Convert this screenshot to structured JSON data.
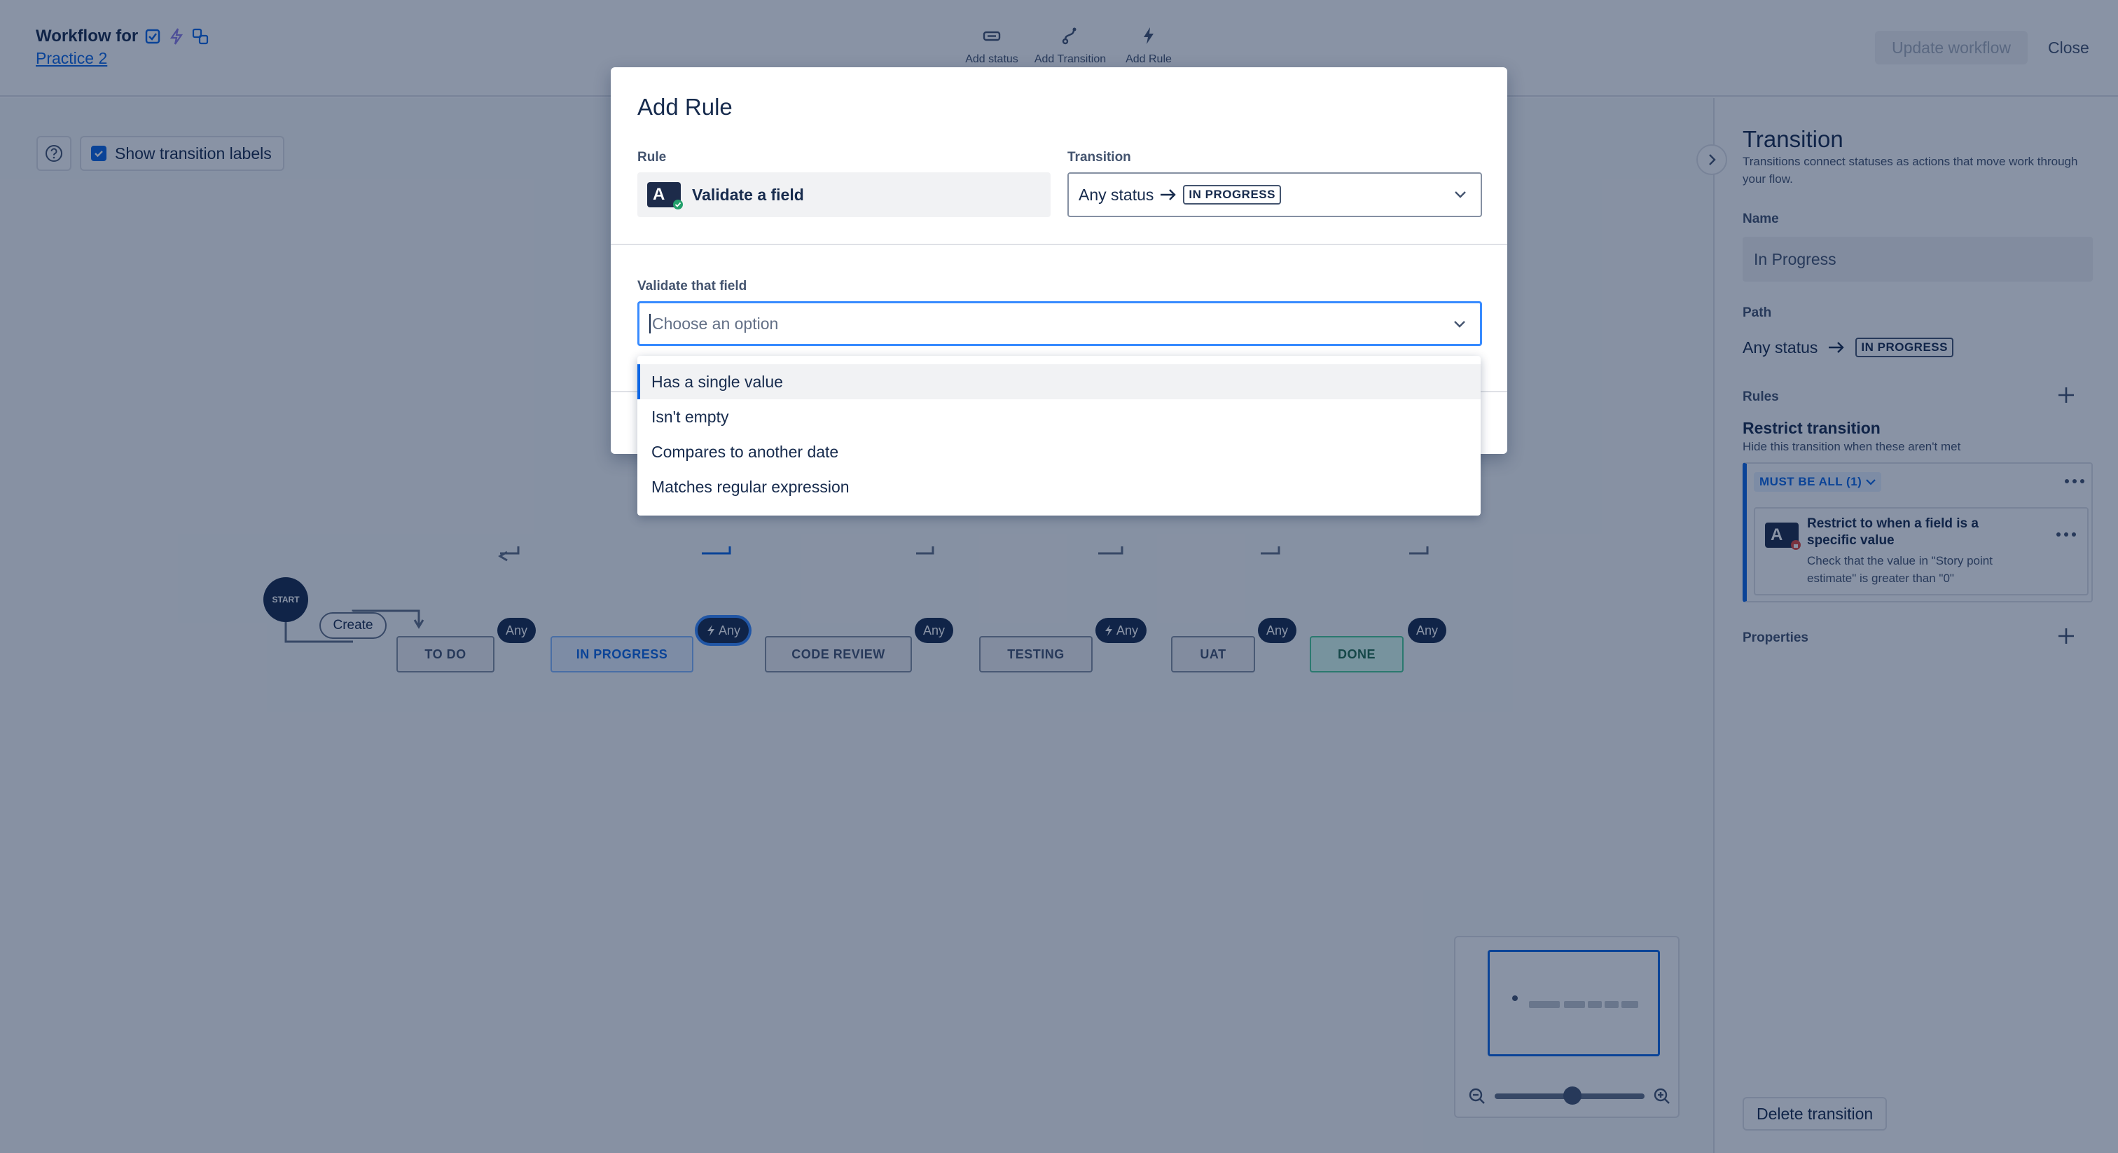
{
  "header": {
    "title_prefix": "Workflow for",
    "project_link": "Practice 2",
    "toolbar": [
      {
        "label": "Add status",
        "icon": "status-icon"
      },
      {
        "label": "Add Transition",
        "icon": "transition-icon"
      },
      {
        "label": "Add Rule",
        "icon": "lightning-icon"
      }
    ],
    "update_label": "Update workflow",
    "close_label": "Close"
  },
  "canvas": {
    "show_labels": "Show transition labels",
    "start": "START",
    "create": "Create",
    "any": "Any",
    "statuses": [
      "TO DO",
      "IN PROGRESS",
      "CODE REVIEW",
      "TESTING",
      "UAT",
      "DONE"
    ]
  },
  "panel": {
    "title": "Transition",
    "description": "Transitions connect statuses as actions that move work through your flow.",
    "name_label": "Name",
    "name_value": "In Progress",
    "path_label": "Path",
    "path_from": "Any status",
    "path_to": "IN PROGRESS",
    "rules_label": "Rules",
    "restrict_title": "Restrict transition",
    "restrict_desc": "Hide this transition when these aren't met",
    "must_badge": "MUST BE ALL (1)",
    "rule_title": "Restrict to when a field is a specific value",
    "rule_desc": "Check that the value in \"Story point estimate\" is greater than \"0\"",
    "properties_label": "Properties",
    "delete_label": "Delete transition"
  },
  "modal": {
    "title": "Add Rule",
    "rule_label": "Rule",
    "rule_value": "Validate a field",
    "transition_label": "Transition",
    "transition_from": "Any status",
    "transition_to": "IN PROGRESS",
    "validate_label": "Validate that field",
    "validate_placeholder": "Choose an option",
    "options": [
      "Has a single value",
      "Isn't empty",
      "Compares to another date",
      "Matches regular expression"
    ]
  },
  "colors": {
    "accent": "#0c66e4",
    "dark": "#172b4d",
    "overlay": "rgba(9,30,66,0.48)"
  }
}
